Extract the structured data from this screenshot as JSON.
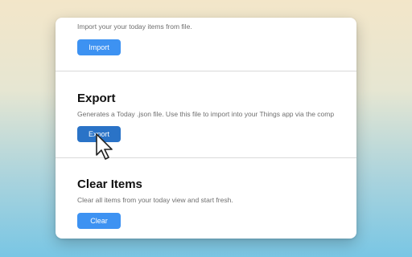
{
  "import_section": {
    "description": "Import your your today items from file.",
    "button_label": "Import"
  },
  "export_section": {
    "title": "Export",
    "description": "Generates a Today .json file. Use this file to import into your Things app via the comp",
    "button_label": "Export"
  },
  "clear_section": {
    "title": "Clear Items",
    "description": "Clear all items from your today view and start fresh.",
    "button_label": "Clear"
  },
  "colors": {
    "button": "#3d92f2",
    "button_active": "#2a73c7"
  },
  "cursor_icon": "arrow-pointer-icon"
}
